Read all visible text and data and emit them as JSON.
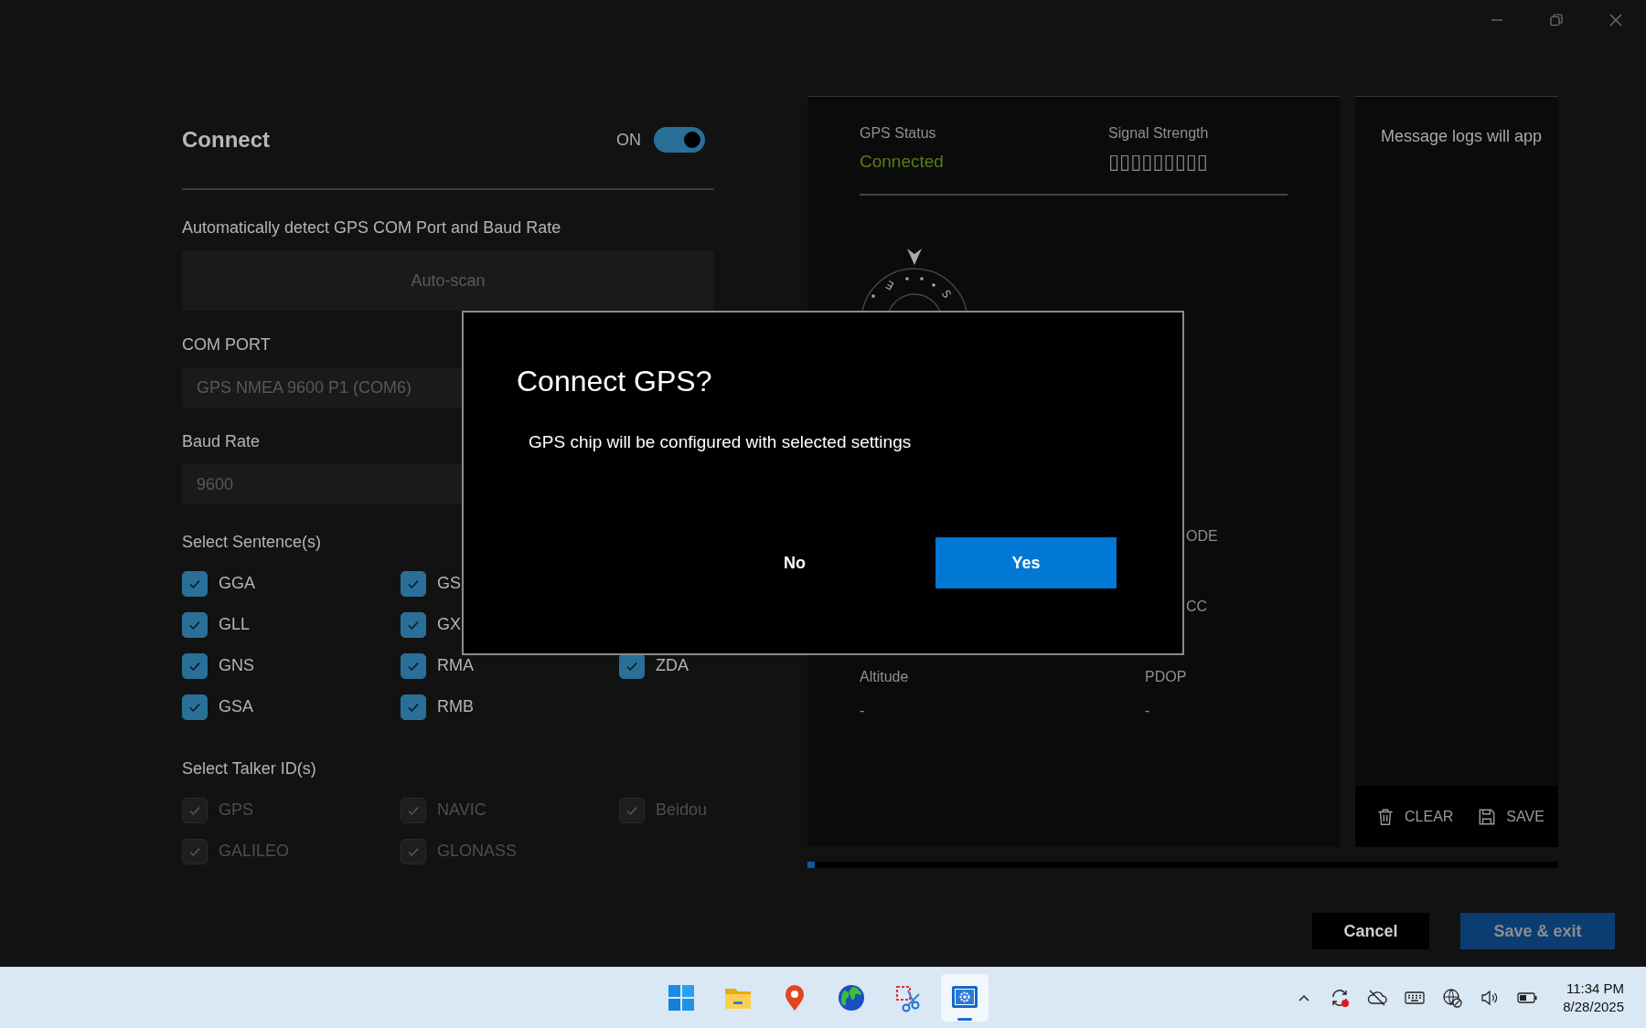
{
  "connect": {
    "title": "Connect",
    "toggle_label": "ON",
    "on": true,
    "auto_label": "Automatically detect GPS COM Port and Baud Rate",
    "auto_button": "Auto-scan",
    "com_port": {
      "label": "COM PORT",
      "value": "GPS NMEA 9600 P1 (COM6)"
    },
    "baud_rate": {
      "label": "Baud Rate",
      "value": "9600"
    },
    "sentences": {
      "label": "Select Sentence(s)",
      "rows": [
        [
          {
            "label": "GGA",
            "checked": true,
            "disabled": false
          },
          {
            "label": "GS",
            "checked": true,
            "disabled": false
          }
        ],
        [
          {
            "label": "GLL",
            "checked": true,
            "disabled": false
          },
          {
            "label": "GX",
            "checked": true,
            "disabled": false
          }
        ],
        [
          {
            "label": "GNS",
            "checked": true,
            "disabled": false
          },
          {
            "label": "RMA",
            "checked": true,
            "disabled": false
          },
          {
            "label": "ZDA",
            "checked": true,
            "disabled": false
          }
        ],
        [
          {
            "label": "GSA",
            "checked": true,
            "disabled": false
          },
          {
            "label": "RMB",
            "checked": true,
            "disabled": false
          }
        ]
      ]
    },
    "talkers": {
      "label": "Select Talker ID(s)",
      "rows": [
        [
          {
            "label": "GPS",
            "checked": true,
            "disabled": true
          },
          {
            "label": "NAVIC",
            "checked": true,
            "disabled": true
          },
          {
            "label": "Beidou",
            "checked": true,
            "disabled": true
          }
        ],
        [
          {
            "label": "GALILEO",
            "checked": true,
            "disabled": true
          },
          {
            "label": "GLONASS",
            "checked": true,
            "disabled": true
          }
        ]
      ]
    }
  },
  "status": {
    "gps_status": {
      "label": "GPS Status",
      "value": "Connected"
    },
    "signal": {
      "label": "Signal Strength",
      "value": "▯▯▯▯▯▯▯▯▯"
    },
    "compass_labels": [
      "E",
      "S"
    ],
    "stats_rows": [
      {
        "cells": [
          {
            "label": "ODE",
            "cut": true
          }
        ]
      },
      {
        "cells": [
          {
            "label": "CC",
            "cut": true
          }
        ]
      },
      {
        "cells": [
          {
            "label": "Altitude",
            "value": "-",
            "cut": false
          },
          {
            "label": "PDOP",
            "value": "-",
            "cut": false
          }
        ]
      }
    ]
  },
  "log": {
    "empty_message": "Message logs will app",
    "actions": [
      {
        "label": "CLEAR",
        "kind": "clear"
      },
      {
        "label": "SAVE",
        "kind": "save"
      }
    ]
  },
  "progress": {
    "level": 0.01
  },
  "footer_buttons": [
    {
      "label": "Cancel",
      "kind": "secondary"
    },
    {
      "label": "Save & exit",
      "kind": "primary"
    }
  ],
  "dialog": {
    "title": "Connect GPS?",
    "message": "GPS chip will be configured with selected settings",
    "buttons": [
      {
        "label": "No",
        "kind": "secondary"
      },
      {
        "label": "Yes",
        "kind": "primary"
      }
    ]
  },
  "taskbar": {
    "apps": [
      {
        "kind": "start",
        "selected": false
      },
      {
        "kind": "folder",
        "selected": false
      },
      {
        "kind": "pin",
        "selected": false
      },
      {
        "kind": "globe",
        "selected": false
      },
      {
        "kind": "snip",
        "selected": false
      },
      {
        "kind": "settings",
        "selected": true
      }
    ],
    "tray": [
      {
        "kind": "chevron"
      },
      {
        "kind": "sync"
      },
      {
        "kind": "cloud"
      },
      {
        "kind": "keyboard"
      },
      {
        "kind": "network"
      },
      {
        "kind": "volume"
      },
      {
        "kind": "battery"
      }
    ],
    "time": "11:34 PM",
    "date": "8/28/2025"
  }
}
